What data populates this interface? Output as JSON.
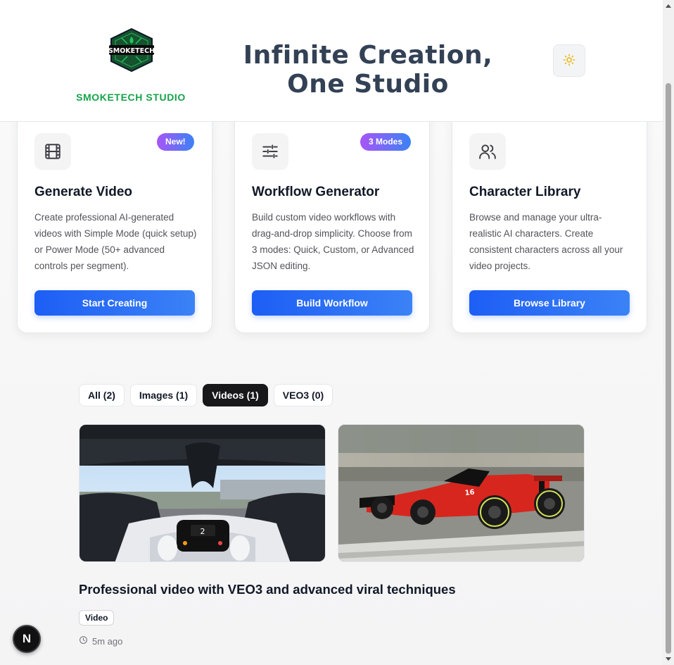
{
  "header": {
    "brand_name": "SMOKETECH STUDIO",
    "logo_text": "SMOKETECH",
    "title": "Infinite Creation, One Studio",
    "theme_toggle_icon": "sun-icon",
    "colors": {
      "brand": "#16a34a",
      "title": "#334155"
    }
  },
  "cards": [
    {
      "icon": "film-icon",
      "badge": "New!",
      "title": "Generate Video",
      "description": "Create professional AI-generated videos with Simple Mode (quick setup) or Power Mode (50+ advanced controls per segment).",
      "button_label": "Start Creating"
    },
    {
      "icon": "sliders-icon",
      "badge": "3 Modes",
      "title": "Workflow Generator",
      "description": "Build custom video workflows with drag-and-drop simplicity. Choose from 3 modes: Quick, Custom, or Advanced JSON editing.",
      "button_label": "Build Workflow"
    },
    {
      "icon": "users-icon",
      "badge": "",
      "title": "Character Library",
      "description": "Browse and manage your ultra-realistic AI characters. Create consistent characters across all your video projects.",
      "button_label": "Browse Library"
    }
  ],
  "filters": [
    {
      "label": "All (2)",
      "active": false
    },
    {
      "label": "Images (1)",
      "active": false
    },
    {
      "label": "Videos (1)",
      "active": true
    },
    {
      "label": "VEO3 (0)",
      "active": false
    }
  ],
  "gallery": {
    "items": [
      {
        "name": "cockpit-view-image"
      },
      {
        "name": "race-car-image"
      }
    ],
    "post_title": "Professional video with VEO3 and advanced viral techniques",
    "post_tag": "Video",
    "post_time": "5m ago",
    "time_icon": "clock-icon"
  },
  "nav_badge": "N",
  "colors": {
    "accent": "#2563eb",
    "badge_gradient_start": "#a855f7",
    "badge_gradient_end": "#3b82f6"
  }
}
